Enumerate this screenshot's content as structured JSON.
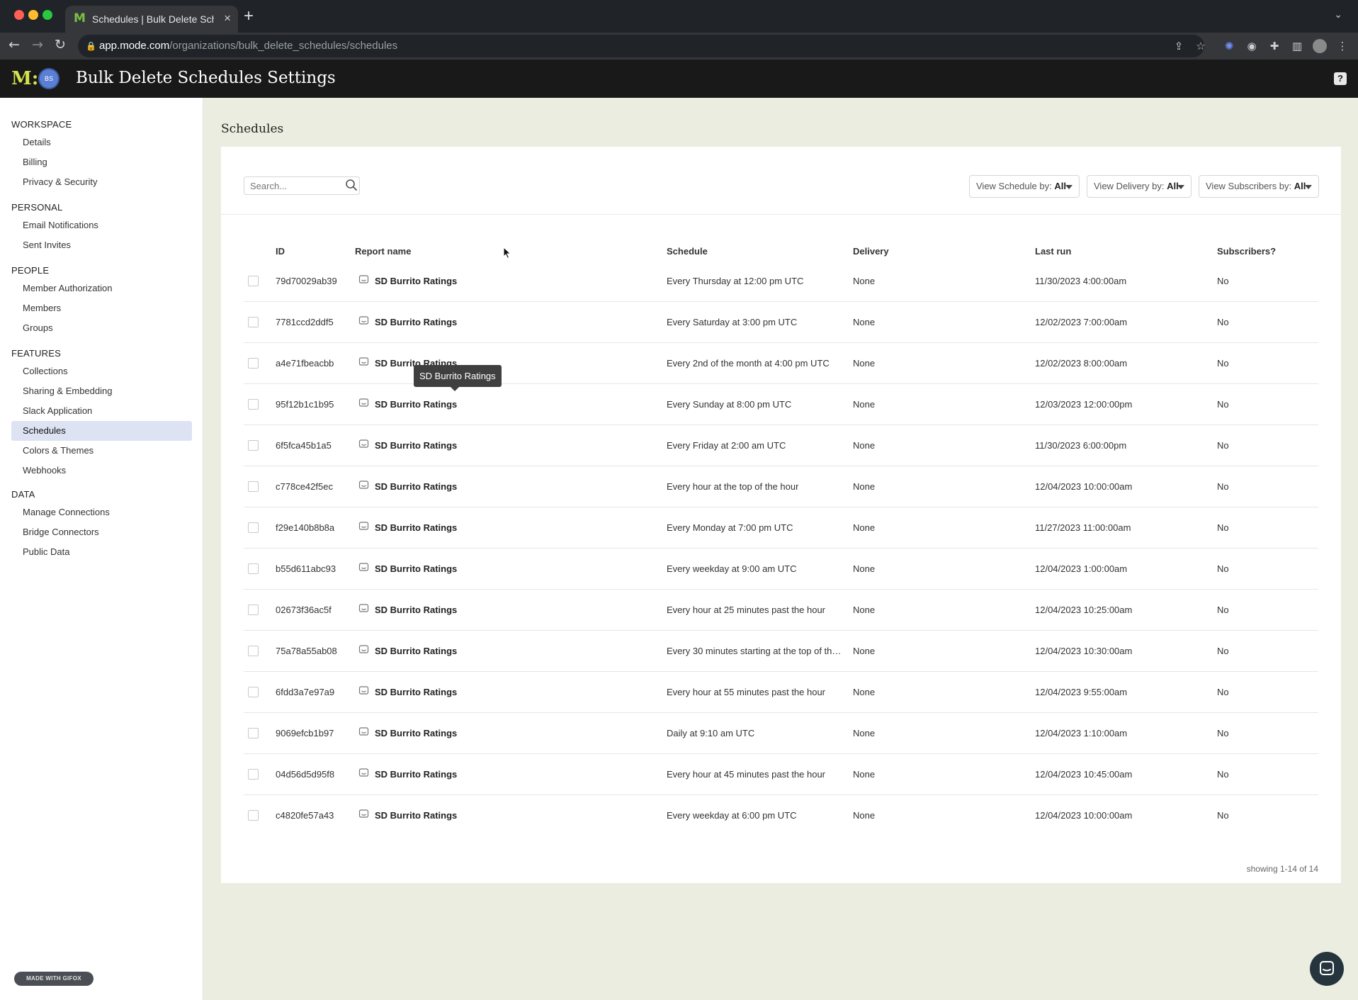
{
  "browser": {
    "tab_title": "Schedules | Bulk Delete Schedules",
    "favicon": "M",
    "url_host": "app.mode.com",
    "url_path": "/organizations/bulk_delete_schedules/schedules"
  },
  "app": {
    "logo": "M:",
    "avatar_initials": "BS",
    "title": "Bulk Delete Schedules Settings"
  },
  "sidebar": {
    "sections": [
      {
        "title": "WORKSPACE",
        "items": [
          "Details",
          "Billing",
          "Privacy & Security"
        ]
      },
      {
        "title": "PERSONAL",
        "items": [
          "Email Notifications",
          "Sent Invites"
        ]
      },
      {
        "title": "PEOPLE",
        "items": [
          "Member Authorization",
          "Members",
          "Groups"
        ]
      },
      {
        "title": "FEATURES",
        "items": [
          "Collections",
          "Sharing & Embedding",
          "Slack Application",
          "Schedules",
          "Colors & Themes",
          "Webhooks"
        ]
      },
      {
        "title": "DATA",
        "items": [
          "Manage Connections",
          "Bridge Connectors",
          "Public Data"
        ]
      }
    ],
    "active_item": "Schedules",
    "gifox_badge": "MADE WITH GIFOX"
  },
  "main": {
    "section_title": "Schedules",
    "search_placeholder": "Search...",
    "filters": [
      {
        "label": "View Schedule by:",
        "value": "All"
      },
      {
        "label": "View Delivery by:",
        "value": "All"
      },
      {
        "label": "View Subscribers by:",
        "value": "All"
      }
    ],
    "columns": [
      "ID",
      "Report name",
      "Schedule",
      "Delivery",
      "Last run",
      "Subscribers?"
    ],
    "rows": [
      {
        "id": "79d70029ab39",
        "report": "SD Burrito Ratings",
        "schedule": "Every Thursday at 12:00 pm UTC",
        "delivery": "None",
        "last_run": "11/30/2023 4:00:00am",
        "subscribers": "No"
      },
      {
        "id": "7781ccd2ddf5",
        "report": "SD Burrito Ratings",
        "schedule": "Every Saturday at 3:00 pm UTC",
        "delivery": "None",
        "last_run": "12/02/2023 7:00:00am",
        "subscribers": "No"
      },
      {
        "id": "a4e71fbeacbb",
        "report": "SD Burrito Ratings",
        "schedule": "Every 2nd of the month at 4:00 pm UTC",
        "delivery": "None",
        "last_run": "12/02/2023 8:00:00am",
        "subscribers": "No"
      },
      {
        "id": "95f12b1c1b95",
        "report": "SD Burrito Ratings",
        "schedule": "Every Sunday at 8:00 pm UTC",
        "delivery": "None",
        "last_run": "12/03/2023 12:00:00pm",
        "subscribers": "No"
      },
      {
        "id": "6f5fca45b1a5",
        "report": "SD Burrito Ratings",
        "schedule": "Every Friday at 2:00 am UTC",
        "delivery": "None",
        "last_run": "11/30/2023 6:00:00pm",
        "subscribers": "No"
      },
      {
        "id": "c778ce42f5ec",
        "report": "SD Burrito Ratings",
        "schedule": "Every hour at the top of the hour",
        "delivery": "None",
        "last_run": "12/04/2023 10:00:00am",
        "subscribers": "No"
      },
      {
        "id": "f29e140b8b8a",
        "report": "SD Burrito Ratings",
        "schedule": "Every Monday at 7:00 pm UTC",
        "delivery": "None",
        "last_run": "11/27/2023 11:00:00am",
        "subscribers": "No"
      },
      {
        "id": "b55d611abc93",
        "report": "SD Burrito Ratings",
        "schedule": "Every weekday at 9:00 am UTC",
        "delivery": "None",
        "last_run": "12/04/2023 1:00:00am",
        "subscribers": "No"
      },
      {
        "id": "02673f36ac5f",
        "report": "SD Burrito Ratings",
        "schedule": "Every hour at 25 minutes past the hour",
        "delivery": "None",
        "last_run": "12/04/2023 10:25:00am",
        "subscribers": "No"
      },
      {
        "id": "75a78a55ab08",
        "report": "SD Burrito Ratings",
        "schedule": "Every 30 minutes starting at the top of the ...",
        "delivery": "None",
        "last_run": "12/04/2023 10:30:00am",
        "subscribers": "No"
      },
      {
        "id": "6fdd3a7e97a9",
        "report": "SD Burrito Ratings",
        "schedule": "Every hour at 55 minutes past the hour",
        "delivery": "None",
        "last_run": "12/04/2023 9:55:00am",
        "subscribers": "No"
      },
      {
        "id": "9069efcb1b97",
        "report": "SD Burrito Ratings",
        "schedule": "Daily at 9:10 am UTC",
        "delivery": "None",
        "last_run": "12/04/2023 1:10:00am",
        "subscribers": "No"
      },
      {
        "id": "04d56d5d95f8",
        "report": "SD Burrito Ratings",
        "schedule": "Every hour at 45 minutes past the hour",
        "delivery": "None",
        "last_run": "12/04/2023 10:45:00am",
        "subscribers": "No"
      },
      {
        "id": "c4820fe57a43",
        "report": "SD Burrito Ratings",
        "schedule": "Every weekday at 6:00 pm UTC",
        "delivery": "None",
        "last_run": "12/04/2023 10:00:00am",
        "subscribers": "No"
      }
    ],
    "tooltip": "SD Burrito Ratings",
    "pager": "showing 1-14 of 14"
  },
  "colors": {
    "page_bg": "#ebede1",
    "active_nav": "#dde3f3",
    "logo": "#d4e24b"
  }
}
